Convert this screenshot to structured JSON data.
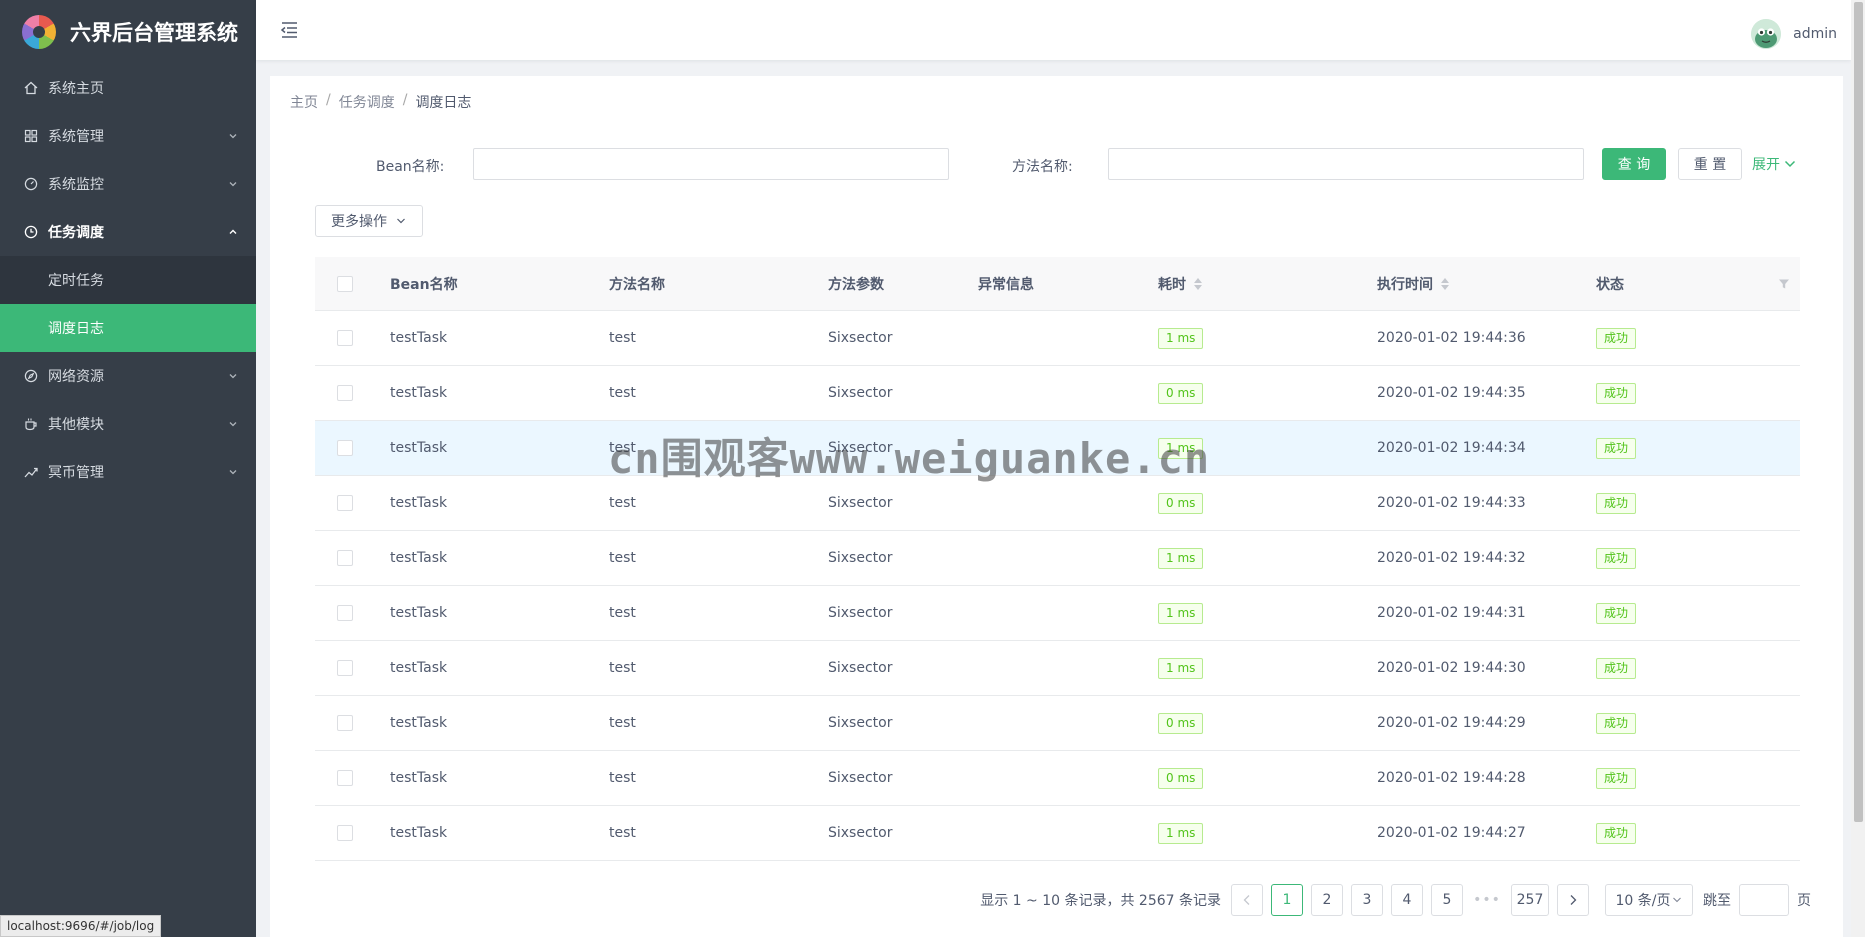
{
  "app": {
    "title": "六界后台管理系统"
  },
  "sidebar": {
    "items": [
      {
        "label": "系统主页",
        "icon": "home-icon"
      },
      {
        "label": "系统管理",
        "icon": "grid-icon"
      },
      {
        "label": "系统监控",
        "icon": "dashboard-icon"
      },
      {
        "label": "任务调度",
        "icon": "clock-icon"
      },
      {
        "label": "网络资源",
        "icon": "compass-icon"
      },
      {
        "label": "其他模块",
        "icon": "cup-icon"
      },
      {
        "label": "冥币管理",
        "icon": "line-chart-icon"
      }
    ],
    "submenu": [
      {
        "label": "定时任务"
      },
      {
        "label": "调度日志"
      }
    ],
    "status_url": "localhost:9696/#/job/log"
  },
  "header": {
    "username": "admin"
  },
  "breadcrumb": {
    "home": "主页",
    "parent": "任务调度",
    "current": "调度日志"
  },
  "filters": {
    "bean_label": "Bean名称:",
    "bean_value": "",
    "method_label": "方法名称:",
    "method_value": "",
    "query_label": "查 询",
    "reset_label": "重 置",
    "expand_label": "展开"
  },
  "more_actions": {
    "label": "更多操作"
  },
  "table": {
    "columns": [
      "Bean名称",
      "方法名称",
      "方法参数",
      "异常信息",
      "耗时",
      "执行时间",
      "状态"
    ],
    "rows": [
      {
        "bean": "testTask",
        "method": "test",
        "params": "Sixsector",
        "error": "",
        "time": "1 ms",
        "exec": "2020-01-02 19:44:36",
        "status": "成功"
      },
      {
        "bean": "testTask",
        "method": "test",
        "params": "Sixsector",
        "error": "",
        "time": "0 ms",
        "exec": "2020-01-02 19:44:35",
        "status": "成功"
      },
      {
        "bean": "testTask",
        "method": "test",
        "params": "Sixsector",
        "error": "",
        "time": "1 ms",
        "exec": "2020-01-02 19:44:34",
        "status": "成功"
      },
      {
        "bean": "testTask",
        "method": "test",
        "params": "Sixsector",
        "error": "",
        "time": "0 ms",
        "exec": "2020-01-02 19:44:33",
        "status": "成功"
      },
      {
        "bean": "testTask",
        "method": "test",
        "params": "Sixsector",
        "error": "",
        "time": "1 ms",
        "exec": "2020-01-02 19:44:32",
        "status": "成功"
      },
      {
        "bean": "testTask",
        "method": "test",
        "params": "Sixsector",
        "error": "",
        "time": "1 ms",
        "exec": "2020-01-02 19:44:31",
        "status": "成功"
      },
      {
        "bean": "testTask",
        "method": "test",
        "params": "Sixsector",
        "error": "",
        "time": "1 ms",
        "exec": "2020-01-02 19:44:30",
        "status": "成功"
      },
      {
        "bean": "testTask",
        "method": "test",
        "params": "Sixsector",
        "error": "",
        "time": "0 ms",
        "exec": "2020-01-02 19:44:29",
        "status": "成功"
      },
      {
        "bean": "testTask",
        "method": "test",
        "params": "Sixsector",
        "error": "",
        "time": "0 ms",
        "exec": "2020-01-02 19:44:28",
        "status": "成功"
      },
      {
        "bean": "testTask",
        "method": "test",
        "params": "Sixsector",
        "error": "",
        "time": "1 ms",
        "exec": "2020-01-02 19:44:27",
        "status": "成功"
      }
    ]
  },
  "pagination": {
    "summary": "显示 1 ~ 10 条记录，共 2567 条记录",
    "pages": [
      "1",
      "2",
      "3",
      "4",
      "5"
    ],
    "ellipsis": "•••",
    "last_page": "257",
    "current_page": "1",
    "page_size": "10 条/页",
    "jump_label": "跳至",
    "jump_suffix": "页"
  },
  "watermark": "cn围观客www.weiguanke.cn",
  "colors": {
    "accent": "#3cb878",
    "sidebar_bg": "#363e48",
    "success_tag": "#52c41a"
  }
}
